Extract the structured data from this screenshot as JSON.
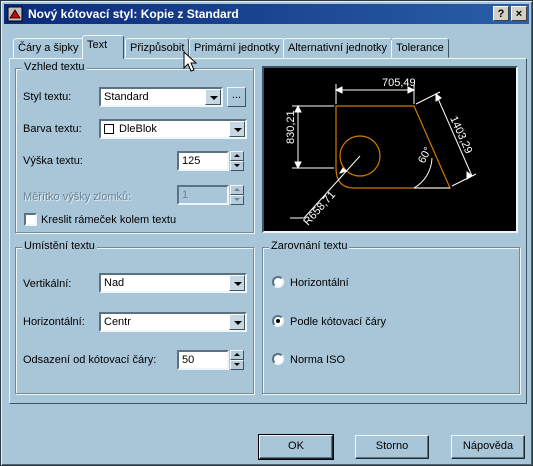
{
  "window": {
    "title": "Nový kótovací styl: Kopie z Standard",
    "help_label": "?",
    "close_label": "×"
  },
  "tabs": [
    {
      "label": "Čáry a šipky",
      "active": false
    },
    {
      "label": "Text",
      "active": true
    },
    {
      "label": "Přizpůsobit",
      "active": false
    },
    {
      "label": "Primární jednotky",
      "active": false
    },
    {
      "label": "Alternativní jednotky",
      "active": false
    },
    {
      "label": "Tolerance",
      "active": false
    }
  ],
  "text_appearance": {
    "title": "Vzhled textu",
    "style_label": "Styl textu:",
    "style_value": "Standard",
    "style_browse_label": "...",
    "color_label": "Barva textu:",
    "color_value": "DleBlok",
    "height_label": "Výška textu:",
    "height_value": "125",
    "fraction_scale_label": "Měřítko výšky zlomků:",
    "fraction_scale_value": "1",
    "frame_label": "Kreslit rámeček kolem textu",
    "frame_checked": false
  },
  "text_placement": {
    "title": "Umístění textu",
    "vertical_label": "Vertikální:",
    "vertical_value": "Nad",
    "horizontal_label": "Horizontální:",
    "horizontal_value": "Centr",
    "offset_label": "Odsazení od kótovací čáry:",
    "offset_value": "50"
  },
  "text_alignment": {
    "title": "Zarovnání textu",
    "options": [
      {
        "label": "Horizontální",
        "selected": false
      },
      {
        "label": "Podle kótovací čáry",
        "selected": true
      },
      {
        "label": "Norma ISO",
        "selected": false
      }
    ]
  },
  "preview": {
    "dim_top": "705,49",
    "dim_left": "830,21",
    "dim_right": "1403,29",
    "dim_angle": "60°",
    "dim_radius": "R658,71",
    "colors": {
      "geometry": "#d07a00",
      "dimension": "#ffffff"
    }
  },
  "buttons": {
    "ok": "OK",
    "cancel": "Storno",
    "help": "Nápověda"
  },
  "icons": [
    "app-icon",
    "help-icon",
    "close-icon",
    "dropdown-arrow-icon",
    "spinner-arrows-icon",
    "mouse-cursor-icon"
  ]
}
